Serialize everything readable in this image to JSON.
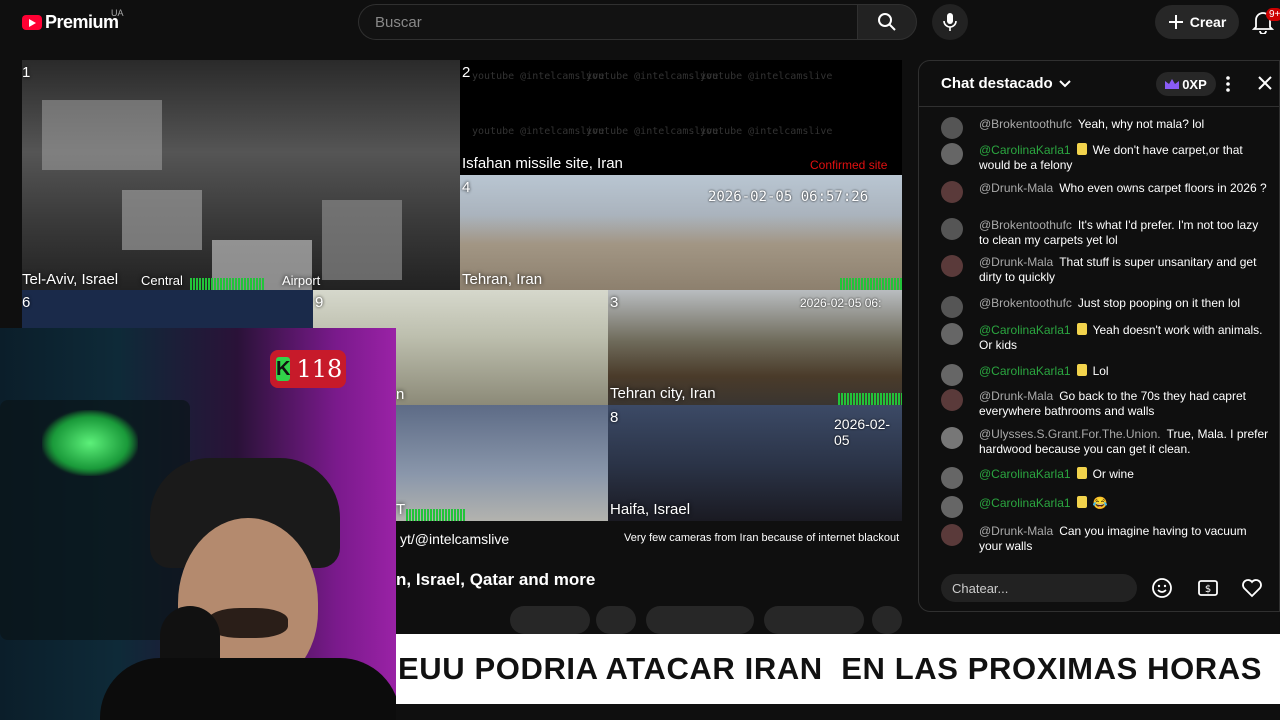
{
  "topbar": {
    "logo_text": "Premium",
    "country": "UA",
    "search_placeholder": "Buscar",
    "create_label": "Crear",
    "notif_count": "9+"
  },
  "feeds": [
    {
      "num": "1",
      "label": "Tel-Aviv, Israel",
      "extra1": "Central",
      "extra2": "Airport"
    },
    {
      "num": "2",
      "label": "Isfahan missile site, Iran",
      "tag": "Confirmed site",
      "watermark": "youtube @intelcamslive"
    },
    {
      "num": "4",
      "label": "Tehran, Iran",
      "stamp": "2026-02-05 06:57:26"
    },
    {
      "num": "6"
    },
    {
      "num": "9",
      "label": "n"
    },
    {
      "num": "3",
      "label": "Tehran city, Iran",
      "stamp": "2026-02-05 06:"
    },
    {
      "num": "8",
      "label": "Haifa, Israel",
      "stamp": "2026-02-05"
    },
    {
      "num": "",
      "label": "T"
    }
  ],
  "overlay_handle": "yt/@intelcamslive",
  "overlay_note": "Very few cameras from Iran because of internet blackout",
  "video_title": "n, Israel, Qatar and more",
  "kick_badge": {
    "letter": "K",
    "count": "118"
  },
  "banner": "EUU PODRIA ATACAR IRAN  EN LAS PROXIMAS HORAS",
  "chat": {
    "title": "Chat destacado",
    "xp": "0XP",
    "input_placeholder": "Chatear...",
    "messages": [
      {
        "author": "@Brokentoothufc",
        "member": false,
        "text": "Yeah, why not mala? lol"
      },
      {
        "author": "@CarolinaKarla1",
        "member": true,
        "text": "We don't have carpet,or that would be a felony"
      },
      {
        "author": "@Drunk-Mala",
        "member": false,
        "text": "Who even owns carpet floors in 2026 ?"
      },
      {
        "author": "@Brokentoothufc",
        "member": false,
        "text": "It's what I'd prefer. I'm not too lazy to clean my carpets yet lol"
      },
      {
        "author": "@Drunk-Mala",
        "member": false,
        "text": "That stuff is super unsanitary and get dirty to quickly"
      },
      {
        "author": "@Brokentoothufc",
        "member": false,
        "text": "Just stop pooping on it then lol"
      },
      {
        "author": "@CarolinaKarla1",
        "member": true,
        "text": "Yeah doesn't work with animals. Or kids"
      },
      {
        "author": "@CarolinaKarla1",
        "member": true,
        "text": "Lol"
      },
      {
        "author": "@Drunk-Mala",
        "member": false,
        "text": "Go back to the 70s they had capret everywhere bathrooms and walls"
      },
      {
        "author": "@Ulysses.S.Grant.For.The.Union.",
        "member": false,
        "text": "True, Mala. I prefer hardwood because you can get it clean."
      },
      {
        "author": "@CarolinaKarla1",
        "member": true,
        "text": "Or wine"
      },
      {
        "author": "@CarolinaKarla1",
        "member": true,
        "text": "😂"
      },
      {
        "author": "@Drunk-Mala",
        "member": false,
        "text": "Can you imagine having to vacuum your walls"
      }
    ]
  }
}
